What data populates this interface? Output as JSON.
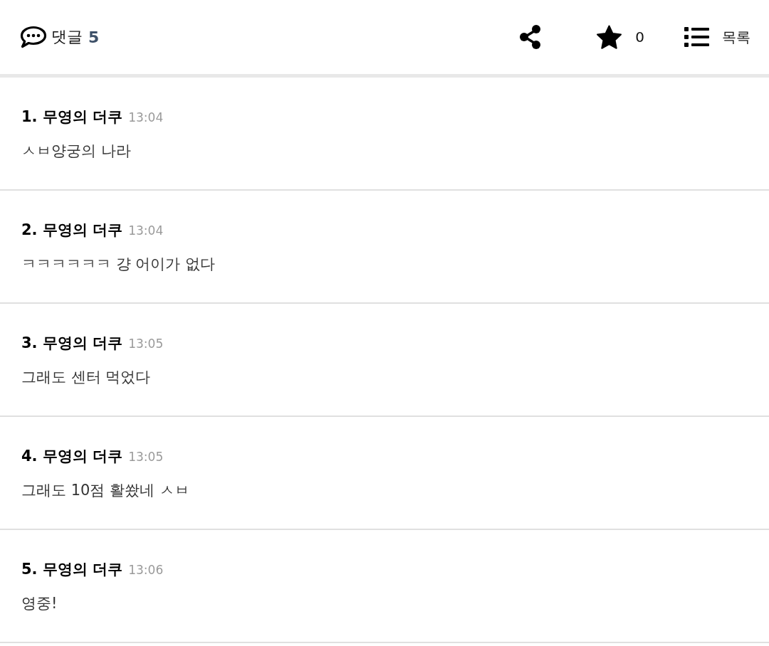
{
  "header": {
    "title": "댓글",
    "count": "5",
    "actions": [
      {
        "kind": "share"
      },
      {
        "kind": "recommend",
        "count": "0"
      },
      {
        "kind": "list",
        "label": "목록"
      }
    ]
  },
  "comments": [
    {
      "number": "1.",
      "author": "무영의 더쿠",
      "time": "13:04",
      "text": "ㅅㅂ양궁의 나라"
    },
    {
      "number": "2.",
      "author": "무영의 더쿠",
      "time": "13:04",
      "text": "ㅋㅋㅋㅋㅋㅋ 걍 어이가 없다"
    },
    {
      "number": "3.",
      "author": "무영의 더쿠",
      "time": "13:05",
      "text": "그래도 센터 먹었다"
    },
    {
      "number": "4.",
      "author": "무영의 더쿠",
      "time": "13:05",
      "text": "그래도 10점 활쐈네 ㅅㅂ"
    },
    {
      "number": "5.",
      "author": "무영의 더쿠",
      "time": "13:06",
      "text": "영중!"
    }
  ]
}
